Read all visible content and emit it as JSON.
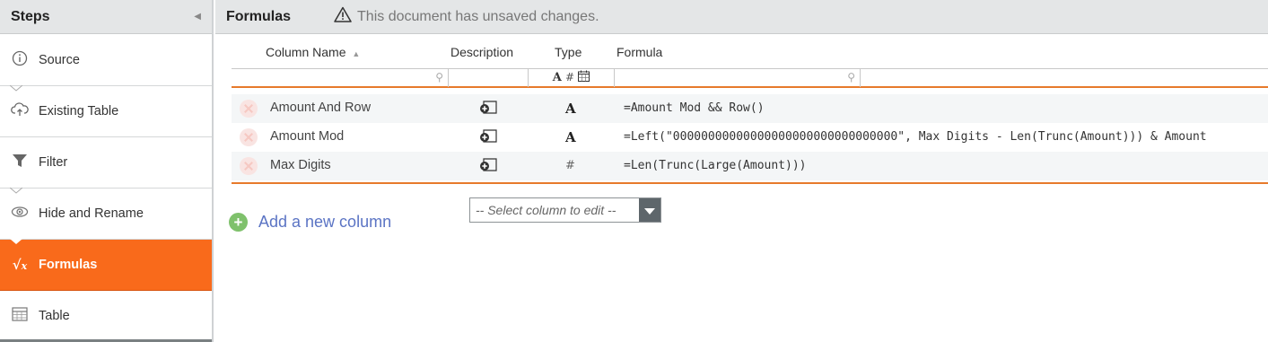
{
  "sidebar": {
    "title": "Steps",
    "steps": [
      {
        "label": "Source",
        "icon": "info-icon"
      },
      {
        "label": "Existing Table",
        "icon": "cloud-upload-icon"
      },
      {
        "label": "Filter",
        "icon": "filter-icon"
      },
      {
        "label": "Hide and Rename",
        "icon": "eye-icon"
      },
      {
        "label": "Formulas",
        "icon": "sqrt-x-icon",
        "active": true
      },
      {
        "label": "Table",
        "icon": "table-icon"
      }
    ]
  },
  "header": {
    "title": "Formulas",
    "warning": "This document has unsaved changes."
  },
  "table": {
    "columns": [
      "Column Name",
      "Description",
      "Type",
      "Formula"
    ],
    "type_filter_icons": "A # 📅",
    "rows": [
      {
        "name": "Amount And Row",
        "type": "A",
        "formula": "=Amount Mod && Row()"
      },
      {
        "name": "Amount Mod",
        "type": "A",
        "formula": "=Left(\"00000000000000000000000000000000\", Max Digits - Len(Trunc(Amount))) & Amount"
      },
      {
        "name": "Max Digits",
        "type": "#",
        "formula": "=Len(Trunc(Large(Amount)))"
      }
    ]
  },
  "add_column_label": "Add a new column",
  "select_placeholder": "-- Select column to edit --",
  "colors": {
    "accent": "#f96a1b",
    "header_bg": "#e4e6e7",
    "link": "#5b74c4",
    "add_green": "#7fc16c"
  }
}
